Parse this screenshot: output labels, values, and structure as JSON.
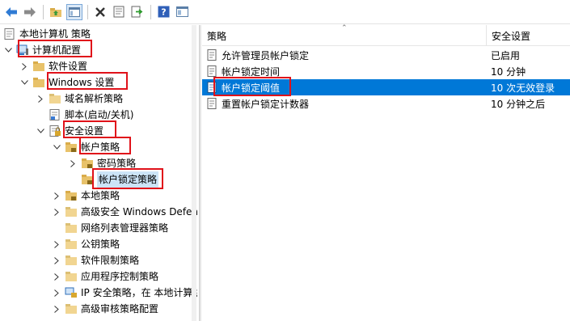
{
  "toolbar": {
    "buttons": [
      "back-icon",
      "forward-icon",
      "up-folder-icon",
      "show-tree-icon",
      "delete-icon",
      "properties-icon",
      "export-icon",
      "help-icon",
      "mmc-icon"
    ]
  },
  "tree": {
    "root": "本地计算机 策略",
    "computer_config": "计算机配置",
    "software_settings": "软件设置",
    "windows_settings": "Windows 设置",
    "dns_policy": "域名解析策略",
    "scripts": "脚本(启动/关机)",
    "security_settings": "安全设置",
    "account_policies": "帐户策略",
    "password_policy": "密码策略",
    "account_lockout_policy": "帐户锁定策略",
    "local_policies": "本地策略",
    "advanced_firewall": "高级安全 Windows Defen",
    "network_list": "网络列表管理器策略",
    "public_key": "公钥策略",
    "software_restriction": "软件限制策略",
    "app_control": "应用程序控制策略",
    "ip_security": "IP 安全策略，在 本地计算机",
    "advanced_audit": "高级审核策略配置"
  },
  "list": {
    "col_policy": "策略",
    "col_setting": "安全设置",
    "rows": [
      {
        "policy": "允许管理员帐户锁定",
        "setting": "已启用"
      },
      {
        "policy": "帐户锁定时间",
        "setting": "10 分钟"
      },
      {
        "policy": "帐户锁定阈值",
        "setting": "10 次无效登录"
      },
      {
        "policy": "重置帐户锁定计数器",
        "setting": "10 分钟之后"
      }
    ],
    "selected_index": 2
  },
  "colors": {
    "selection": "#0078d7",
    "highlight": "#e0121a",
    "folder": "#e8c26a"
  }
}
